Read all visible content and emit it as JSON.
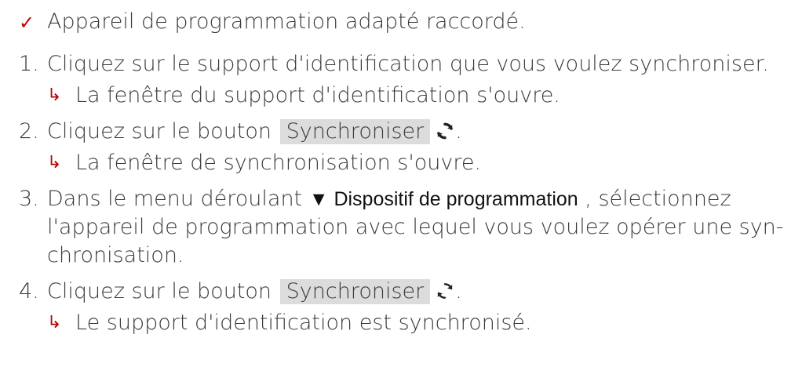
{
  "prerequisite": {
    "icon": "check-icon",
    "text": "Appareil de programmation adapté raccordé."
  },
  "steps": [
    {
      "number": "1.",
      "text": "Cliquez sur le support d'identification que vous voulez synchroniser.",
      "result": "La fenêtre du support d'identification s'ouvre."
    },
    {
      "number": "2.",
      "before": "Cliquez sur le bouton",
      "button": "Synchroniser",
      "after": ".",
      "result": "La fenêtre de synchronisation s'ouvre."
    },
    {
      "number": "3.",
      "line1_before": "Dans le menu déroulant",
      "menu_symbol": "▼",
      "menu": "Dispositif de programmation",
      "line1_after": ", sélectionnez",
      "line2": "l'appareil de programmation avec lequel vous voulez opérer une syn-",
      "line3": "chronisation."
    },
    {
      "number": "4.",
      "before": "Cliquez sur le bouton",
      "button": "Synchroniser",
      "after": ".",
      "result": "Le support d'identification est synchronisé."
    }
  ],
  "colors": {
    "accent": "#c00000",
    "text": "#3a3a3a",
    "button_bg": "#dcdcdc"
  }
}
